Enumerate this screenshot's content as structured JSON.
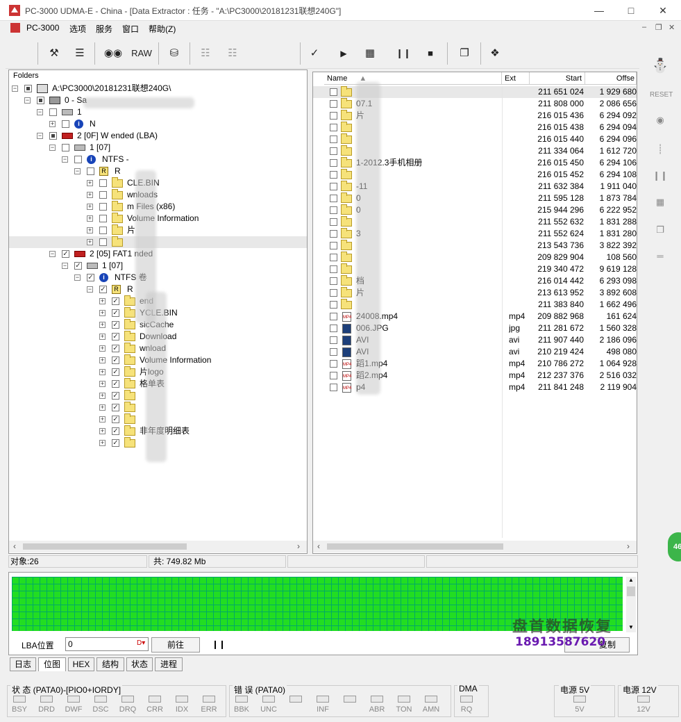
{
  "window": {
    "title": "PC-3000 UDMA-E - China - [Data Extractor : 任务 - \"A:\\PC3000\\20181231联想240G\"]"
  },
  "menu": [
    "PC-3000",
    "选项",
    "服务",
    "窗口",
    "帮助(Z)"
  ],
  "toolbar": {
    "raw_label": "RAW"
  },
  "folders": {
    "header": "Folders",
    "rows": [
      {
        "text": "A:\\PC3000\\20181231联想240G\\"
      },
      {
        "text": "0 - Sa"
      },
      {
        "text": "1"
      },
      {
        "text": "N"
      },
      {
        "text": "2 [0F] W          ended  (LBA)"
      },
      {
        "text": "1 [07]"
      },
      {
        "text": "NTFS - "
      },
      {
        "text": "R"
      },
      {
        "text": "CLE.BIN"
      },
      {
        "text": "wnloads"
      },
      {
        "text": "m Files (x86)"
      },
      {
        "text": "Volume Information"
      },
      {
        "text": "片"
      },
      {
        "text": ""
      },
      {
        "text": "2 [05] FAT1       nded"
      },
      {
        "text": "1 [07]"
      },
      {
        "text": "NTFS      卷"
      },
      {
        "text": "R"
      },
      {
        "text": "end"
      },
      {
        "text": "YCLE.BIN"
      },
      {
        "text": "sicCache"
      },
      {
        "text": "Download"
      },
      {
        "text": "wnload"
      },
      {
        "text": "Volume Information"
      },
      {
        "text": "片logo"
      },
      {
        "text": "格单表"
      },
      {
        "text": ""
      },
      {
        "text": ""
      },
      {
        "text": ""
      },
      {
        "text": "非年度明细表"
      },
      {
        "text": ""
      }
    ]
  },
  "files": {
    "columns": [
      "Name",
      "Ext",
      "Start",
      "Offse"
    ],
    "rows": [
      {
        "name": "",
        "ext": "",
        "start": "211 651 024",
        "offset": "1 929 680"
      },
      {
        "name": "07.1",
        "ext": "",
        "start": "211 808 000",
        "offset": "2 086 656"
      },
      {
        "name": "片",
        "ext": "",
        "start": "216 015 436",
        "offset": "6 294 092"
      },
      {
        "name": "",
        "ext": "",
        "start": "216 015 438",
        "offset": "6 294 094"
      },
      {
        "name": "",
        "ext": "",
        "start": "216 015 440",
        "offset": "6 294 096"
      },
      {
        "name": "",
        "ext": "",
        "start": "211 334 064",
        "offset": "1 612 720"
      },
      {
        "name": "1-2012.3手机相册",
        "ext": "",
        "start": "216 015 450",
        "offset": "6 294 106"
      },
      {
        "name": "",
        "ext": "",
        "start": "216 015 452",
        "offset": "6 294 108"
      },
      {
        "name": "-11",
        "ext": "",
        "start": "211 632 384",
        "offset": "1 911 040"
      },
      {
        "name": "0",
        "ext": "",
        "start": "211 595 128",
        "offset": "1 873 784"
      },
      {
        "name": "0",
        "ext": "",
        "start": "215 944 296",
        "offset": "6 222 952"
      },
      {
        "name": "",
        "ext": "",
        "start": "211 552 632",
        "offset": "1 831 288"
      },
      {
        "name": "3",
        "ext": "",
        "start": "211 552 624",
        "offset": "1 831 280"
      },
      {
        "name": "",
        "ext": "",
        "start": "213 543 736",
        "offset": "3 822 392"
      },
      {
        "name": "",
        "ext": "",
        "start": "209 829 904",
        "offset": "108 560"
      },
      {
        "name": "",
        "ext": "",
        "start": "219 340 472",
        "offset": "9 619 128"
      },
      {
        "name": "档",
        "ext": "",
        "start": "216 014 442",
        "offset": "6 293 098"
      },
      {
        "name": "片",
        "ext": "",
        "start": "213 613 952",
        "offset": "3 892 608"
      },
      {
        "name": "",
        "ext": "",
        "start": "211 383 840",
        "offset": "1 662 496"
      },
      {
        "name": "24008.mp4",
        "ext": "mp4",
        "start": "209 882 968",
        "offset": "161 624"
      },
      {
        "name": "006.JPG",
        "ext": "jpg",
        "start": "211 281 672",
        "offset": "1 560 328"
      },
      {
        "name": "AVI",
        "ext": "avi",
        "start": "211 907 440",
        "offset": "2 186 096"
      },
      {
        "name": "AVI",
        "ext": "avi",
        "start": "210 219 424",
        "offset": "498 080"
      },
      {
        "name": "蹈1.mp4",
        "ext": "mp4",
        "start": "210 786 272",
        "offset": "1 064 928"
      },
      {
        "name": "蹈2.mp4",
        "ext": "mp4",
        "start": "212 237 376",
        "offset": "2 516 032"
      },
      {
        "name": "p4",
        "ext": "mp4",
        "start": "211 841 248",
        "offset": "2 119 904"
      }
    ]
  },
  "status": {
    "objects": "对象:26",
    "total": "共: 749.82 Mb"
  },
  "map": {
    "lba_label": "LBA位置",
    "lba_value": "0",
    "goto_label": "前往",
    "copy_label": "复制"
  },
  "tabs": [
    "日志",
    "位图",
    "HEX",
    "结构",
    "状态",
    "进程"
  ],
  "indicators": {
    "status_title": "状 态 (PATA0)-[PIO0+IORDY]",
    "status_leds": [
      "BSY",
      "DRD",
      "DWF",
      "DSC",
      "DRQ",
      "CRR",
      "IDX",
      "ERR"
    ],
    "error_title": "错 误 (PATA0)",
    "error_leds": [
      "BBK",
      "UNC",
      "",
      "INF",
      "",
      "ABR",
      "TON",
      "AMN"
    ],
    "dma_title": "DMA",
    "dma_leds": [
      "RQ"
    ],
    "p5_title": "电源 5V",
    "p5_leds": [
      "5V"
    ],
    "p12_title": "电源 12V",
    "p12_leds": [
      "12V"
    ]
  },
  "watermark": {
    "line1": "盘首数据恢复",
    "line2": "18913587620"
  },
  "badge": "46"
}
